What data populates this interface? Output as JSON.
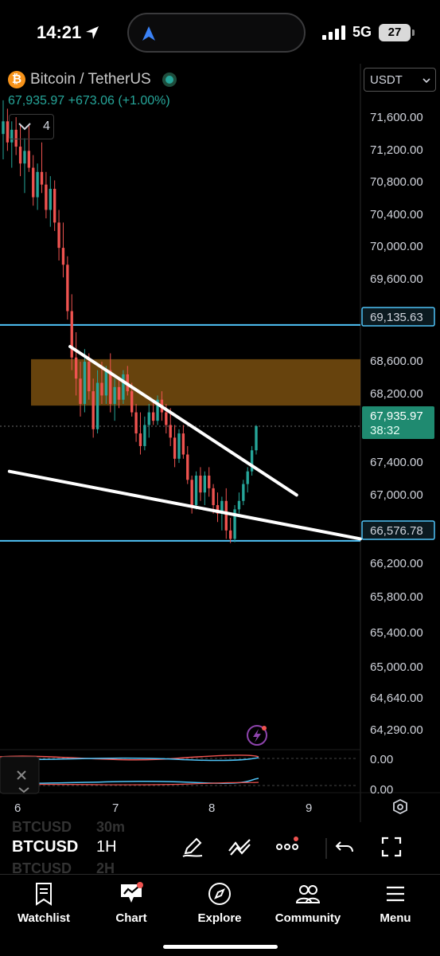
{
  "status_bar": {
    "time": "14:21",
    "network": "5G",
    "battery": "27"
  },
  "header": {
    "symbol_title": "Bitcoin / TetherUS",
    "last_price": "67,935.97",
    "change": "+673.06 (+1.00%)",
    "indicator_count": "4",
    "currency": "USDT"
  },
  "price_axis": {
    "ticks": [
      "71,600.00",
      "71,200.00",
      "70,800.00",
      "70,400.00",
      "70,000.00",
      "69,600.00",
      "68,600.00",
      "68,200.00",
      "67,400.00",
      "67,000.00",
      "66,200.00",
      "65,800.00",
      "65,400.00",
      "65,000.00",
      "64,640.00",
      "64,290.00"
    ],
    "label_upper": "69,135.63",
    "label_current_price": "67,935.97",
    "label_countdown": "38:32",
    "label_lower": "66,576.78",
    "indicator_ticks": [
      "0.00",
      "0.00"
    ]
  },
  "time_axis": {
    "ticks": [
      "6",
      "7",
      "8",
      "9"
    ]
  },
  "chart_data": {
    "type": "candlestick",
    "symbol": "BTCUSDT",
    "interval": "1H",
    "y_range": [
      64200,
      71800
    ],
    "x_days": [
      "6",
      "7",
      "8",
      "9"
    ],
    "last_price": 67935.97,
    "horizontal_lines": [
      69135.63,
      66576.78
    ],
    "zone": {
      "from": 68180,
      "to": 68730
    },
    "trendlines": [
      {
        "from": [
          "6 13:00",
          68880
        ],
        "to": [
          "8 21:00",
          67120
        ]
      },
      {
        "from": [
          "5 22:00",
          67400
        ],
        "to": [
          "9 03:00",
          66600
        ]
      }
    ],
    "candles": [
      [
        71400,
        71800,
        71100,
        71550
      ],
      [
        71550,
        71700,
        71200,
        71300
      ],
      [
        71300,
        71550,
        71000,
        71450
      ],
      [
        71450,
        71600,
        71150,
        71250
      ],
      [
        71250,
        71500,
        70900,
        71050
      ],
      [
        71050,
        71350,
        70700,
        71200
      ],
      [
        71200,
        71500,
        70950,
        71000
      ],
      [
        71000,
        71150,
        70550,
        70650
      ],
      [
        70650,
        71050,
        70500,
        70950
      ],
      [
        70950,
        71300,
        70700,
        70800
      ],
      [
        70800,
        70950,
        70400,
        70500
      ],
      [
        70500,
        70900,
        70300,
        70750
      ],
      [
        70750,
        70850,
        70250,
        70350
      ],
      [
        70350,
        70500,
        69900,
        70050
      ],
      [
        70050,
        70350,
        69700,
        69850
      ],
      [
        69850,
        69950,
        69200,
        69300
      ],
      [
        69300,
        69500,
        68600,
        68750
      ],
      [
        68750,
        69050,
        68300,
        68500
      ],
      [
        68500,
        68700,
        68050,
        68200
      ],
      [
        68200,
        68850,
        68100,
        68700
      ],
      [
        68700,
        68800,
        68250,
        68350
      ],
      [
        68350,
        68500,
        67800,
        67900
      ],
      [
        67900,
        68600,
        67850,
        68450
      ],
      [
        68450,
        68700,
        68200,
        68300
      ],
      [
        68300,
        68650,
        68200,
        68600
      ],
      [
        68600,
        68800,
        68100,
        68200
      ],
      [
        68200,
        68500,
        68000,
        68400
      ],
      [
        68400,
        68500,
        68150,
        68250
      ],
      [
        68250,
        68600,
        68200,
        68550
      ],
      [
        68550,
        68650,
        68300,
        68350
      ],
      [
        68350,
        68450,
        68050,
        68100
      ],
      [
        68100,
        68200,
        67750,
        67850
      ],
      [
        67850,
        68100,
        67600,
        67700
      ],
      [
        67700,
        68050,
        67650,
        67950
      ],
      [
        67950,
        68200,
        67800,
        68100
      ],
      [
        68100,
        68250,
        67950,
        68000
      ],
      [
        68000,
        68300,
        67950,
        68250
      ],
      [
        68250,
        68350,
        68000,
        68100
      ],
      [
        68100,
        68200,
        67850,
        67950
      ],
      [
        67950,
        68150,
        67700,
        67800
      ],
      [
        67800,
        67950,
        67450,
        67550
      ],
      [
        67550,
        67900,
        67500,
        67850
      ],
      [
        67850,
        67950,
        67550,
        67600
      ],
      [
        67600,
        67700,
        67250,
        67300
      ],
      [
        67300,
        67350,
        66900,
        67000
      ],
      [
        67000,
        67400,
        66950,
        67350
      ],
      [
        67350,
        67450,
        67050,
        67150
      ],
      [
        67150,
        67400,
        67000,
        67350
      ],
      [
        67350,
        67450,
        67100,
        67200
      ],
      [
        67200,
        67250,
        66900,
        67000
      ],
      [
        67000,
        67150,
        66800,
        66900
      ],
      [
        66900,
        67100,
        66700,
        67050
      ],
      [
        67050,
        67200,
        66600,
        66700
      ],
      [
        66700,
        66850,
        66550,
        66600
      ],
      [
        66600,
        67000,
        66560,
        66950
      ],
      [
        66950,
        67150,
        66900,
        67050
      ],
      [
        67050,
        67300,
        67000,
        67250
      ],
      [
        67250,
        67450,
        67150,
        67400
      ],
      [
        67400,
        67700,
        67350,
        67650
      ],
      [
        67650,
        67950,
        67600,
        67935.97
      ]
    ]
  },
  "toolbar": {
    "symbol": "BTCUSD",
    "interval": "1H",
    "ghost_symbol_above": "BTCUSD",
    "ghost_interval_above": "30m",
    "ghost_symbol_below": "BTCUSD",
    "ghost_interval_below": "2H"
  },
  "bottom_nav": [
    {
      "label": "Watchlist",
      "icon": "bookmark-icon"
    },
    {
      "label": "Chart",
      "icon": "chart-icon"
    },
    {
      "label": "Explore",
      "icon": "compass-icon"
    },
    {
      "label": "Community",
      "icon": "people-icon"
    },
    {
      "label": "Menu",
      "icon": "menu-icon"
    }
  ],
  "colors": {
    "up": "#26a69a",
    "down": "#ef5350",
    "horizontal_line": "#4fc3f7",
    "zone": "#8a5a12",
    "trendline": "#ffffff",
    "current_price_label": "#1f8a70"
  }
}
